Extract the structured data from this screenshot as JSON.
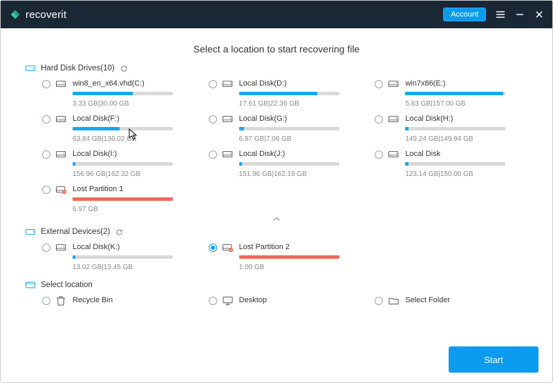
{
  "titlebar": {
    "product": "recoverit",
    "account_label": "Account"
  },
  "headline": "Select a location to start recovering file",
  "sections": {
    "hdd": {
      "title": "Hard Disk Drives(10)"
    },
    "ext": {
      "title": "External Devices(2)"
    },
    "loc": {
      "title": "Select location"
    }
  },
  "hdd": [
    {
      "name": "win8_en_x64.vhd(C:)",
      "used": "3.33  GB",
      "total": "30.00  GB",
      "pct": 60,
      "type": "normal"
    },
    {
      "name": "Local Disk(D:)",
      "used": "17.61  GB",
      "total": "22.36  GB",
      "pct": 78,
      "type": "normal"
    },
    {
      "name": "win7x86(E:)",
      "used": "5.83  GB",
      "total": "157.00  GB",
      "pct": 98,
      "type": "normal"
    },
    {
      "name": "Local Disk(F:)",
      "used": "63.84  GB",
      "total": "136.02  GB",
      "pct": 47,
      "type": "normal"
    },
    {
      "name": "Local Disk(G:)",
      "used": "6.87  GB",
      "total": "7.06  GB",
      "pct": 5,
      "type": "normal"
    },
    {
      "name": "Local Disk(H:)",
      "used": "149.24  GB",
      "total": "149.94  GB",
      "pct": 3,
      "type": "normal"
    },
    {
      "name": "Local Disk(I:)",
      "used": "156.96  GB",
      "total": "162.32  GB",
      "pct": 3,
      "type": "normal"
    },
    {
      "name": "Local Disk(J:)",
      "used": "151.96  GB",
      "total": "162.19  GB",
      "pct": 3,
      "type": "normal"
    },
    {
      "name": "Local Disk",
      "used": "123.14  GB",
      "total": "150.00  GB",
      "pct": 3,
      "type": "normal"
    },
    {
      "name": "Lost Partition 1",
      "used": "6.97  GB",
      "total": "",
      "pct": 100,
      "type": "lost"
    }
  ],
  "ext": [
    {
      "name": "Local Disk(K:)",
      "used": "13.02  GB",
      "total": "13.45  GB",
      "pct": 3,
      "type": "normal",
      "selected": false
    },
    {
      "name": "Lost Partition 2",
      "used": "1.00  GB",
      "total": "",
      "pct": 100,
      "type": "lost",
      "selected": true
    }
  ],
  "loc": [
    {
      "name": "Recycle Bin"
    },
    {
      "name": "Desktop"
    },
    {
      "name": "Select Folder"
    }
  ],
  "start_label": "Start"
}
